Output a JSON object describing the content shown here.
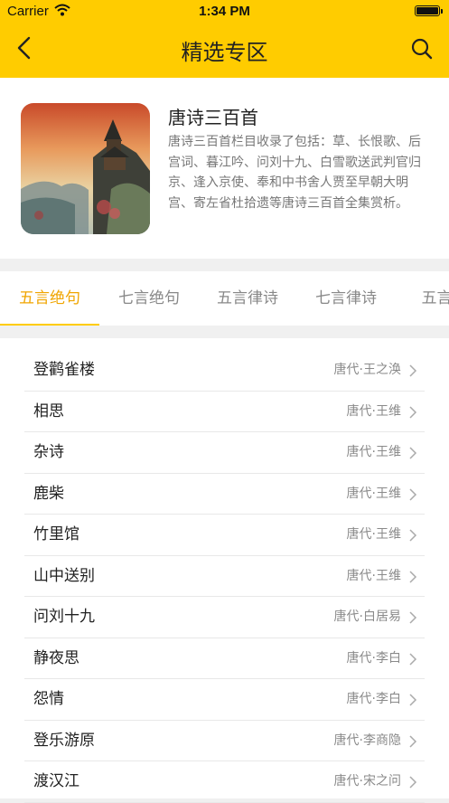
{
  "status_bar": {
    "carrier": "Carrier",
    "time": "1:34 PM",
    "battery_level": 1.0
  },
  "nav": {
    "title": "精选专区",
    "back_icon": "chevron-left-icon",
    "search_icon": "search-icon"
  },
  "intro": {
    "title": "唐诗三百首",
    "description": "唐诗三百首栏目收录了包括：草、长恨歌、后宫词、暮江吟、问刘十九、白雪歌送武判官归京、逢入京使、奉和中书舍人贾至早朝大明宫、寄左省杜拾遗等唐诗三百首全集赏析。"
  },
  "tabs": [
    {
      "label": "五言绝句",
      "active": true
    },
    {
      "label": "七言绝句",
      "active": false
    },
    {
      "label": "五言律诗",
      "active": false
    },
    {
      "label": "七言律诗",
      "active": false
    },
    {
      "label": "五言古",
      "active": false
    }
  ],
  "poems": [
    {
      "title": "登鹳雀楼",
      "meta": "唐代·王之涣"
    },
    {
      "title": "相思",
      "meta": "唐代·王维"
    },
    {
      "title": "杂诗",
      "meta": "唐代·王维"
    },
    {
      "title": "鹿柴",
      "meta": "唐代·王维"
    },
    {
      "title": "竹里馆",
      "meta": "唐代·王维"
    },
    {
      "title": "山中送别",
      "meta": "唐代·王维"
    },
    {
      "title": "问刘十九",
      "meta": "唐代·白居易"
    },
    {
      "title": "静夜思",
      "meta": "唐代·李白"
    },
    {
      "title": "怨情",
      "meta": "唐代·李白"
    },
    {
      "title": "登乐游原",
      "meta": "唐代·李商隐"
    },
    {
      "title": "渡汉江",
      "meta": "唐代·宋之问"
    }
  ],
  "colors": {
    "accent": "#ffcc00",
    "active_tab_text": "#f0a500"
  }
}
